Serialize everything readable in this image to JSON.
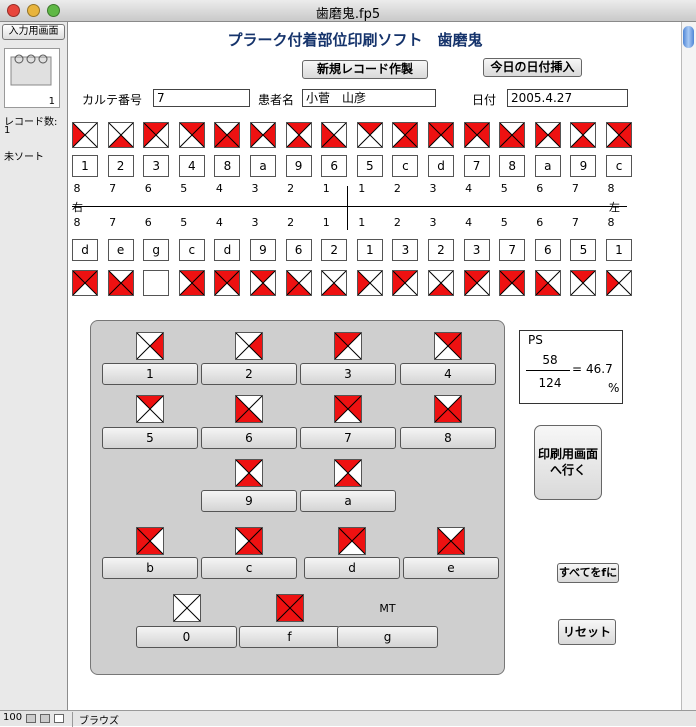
{
  "window": {
    "title": "歯磨鬼.fp5"
  },
  "sidebar": {
    "layout_button": "入力用画面",
    "record_number": "1",
    "records_label": "レコード数:",
    "records_count": "1",
    "sort_status": "未ソート"
  },
  "status": {
    "zoom": "100",
    "mode": "ブラウズ"
  },
  "header": {
    "title": "プラーク付着部位印刷ソフト　歯磨鬼",
    "new_record_button": "新規レコード作製",
    "insert_date_button": "今日の日付挿入"
  },
  "form": {
    "chart_no_label": "カルテ番号",
    "chart_no": "7",
    "patient_label": "患者名",
    "patient_name": "小菅　山彦",
    "date_label": "日付",
    "date": "2005.4.27"
  },
  "upper_codes": [
    "1",
    "2",
    "3",
    "4",
    "8",
    "a",
    "9",
    "6",
    "5",
    "c",
    "d",
    "7",
    "8",
    "a",
    "9",
    "c"
  ],
  "upper_numbers": [
    "8",
    "7",
    "6",
    "5",
    "4",
    "3",
    "2",
    "1",
    "1",
    "2",
    "3",
    "4",
    "5",
    "6",
    "7",
    "8"
  ],
  "lower_numbers": [
    "8",
    "7",
    "6",
    "5",
    "4",
    "3",
    "2",
    "1",
    "1",
    "2",
    "3",
    "4",
    "5",
    "6",
    "7",
    "8"
  ],
  "right_label": "右",
  "left_label": "左",
  "lower_codes": [
    "d",
    "e",
    "g",
    "c",
    "d",
    "9",
    "6",
    "2",
    "1",
    "3",
    "2",
    "3",
    "7",
    "6",
    "5",
    "1"
  ],
  "upper_teeth": [
    "1",
    "2",
    "3",
    "4",
    "8",
    "a",
    "9",
    "6",
    "5",
    "c",
    "d",
    "7",
    "8",
    "a",
    "9",
    "c"
  ],
  "lower_teeth": [
    "d",
    "e",
    "",
    "c",
    "d",
    "9",
    "6",
    "2",
    "1",
    "3",
    "2",
    "3",
    "7",
    "6",
    "5",
    "1"
  ],
  "patterns": {
    "0": [],
    "1": [
      "L"
    ],
    "2": [
      "B"
    ],
    "3": [
      "T",
      "L"
    ],
    "4": [
      "T",
      "R"
    ],
    "5": [
      "T"
    ],
    "6": [
      "L",
      "B"
    ],
    "7": [
      "T",
      "R",
      "L"
    ],
    "8": [
      "L",
      "R",
      "B"
    ],
    "9": [
      "T",
      "B"
    ],
    "a": [
      "L",
      "R"
    ],
    "b": [
      "T",
      "L",
      "B"
    ],
    "c": [
      "T",
      "R",
      "B"
    ],
    "d": [
      "T",
      "L",
      "R"
    ],
    "e": [
      "L",
      "R",
      "B"
    ],
    "f": [
      "T",
      "R",
      "B",
      "L"
    ],
    "g": [],
    "r": [
      "R"
    ]
  },
  "panel": {
    "row1": [
      {
        "icon": "r",
        "label": "1"
      },
      {
        "icon": "r",
        "label": "2"
      },
      {
        "icon": "3",
        "label": "3"
      },
      {
        "icon": "4",
        "label": "4"
      }
    ],
    "row2": [
      {
        "icon": "5",
        "label": "5"
      },
      {
        "icon": "6",
        "label": "6"
      },
      {
        "icon": "7",
        "label": "7"
      },
      {
        "icon": "8",
        "label": "8"
      }
    ],
    "row3": [
      {
        "icon": "9",
        "label": "9"
      },
      {
        "icon": "9",
        "label": "a"
      }
    ],
    "row4": [
      {
        "icon": "b",
        "label": "b"
      },
      {
        "icon": "c",
        "label": "c"
      },
      {
        "icon": "d",
        "label": "d"
      },
      {
        "icon": "e",
        "label": "e"
      }
    ],
    "row5": [
      {
        "icon": "0",
        "label": "0"
      },
      {
        "icon": "f",
        "label": "f"
      },
      {
        "icon": "",
        "label": "g",
        "caption": "MT"
      }
    ]
  },
  "ps": {
    "label": "PS",
    "numerator": "58",
    "denominator": "124",
    "equals": "=",
    "value": "46.7",
    "unit": "%"
  },
  "buttons": {
    "print_screen": "印刷用画面へ行く",
    "all_f": "すべてをfに",
    "reset": "リセット"
  },
  "colors": {
    "red": "#ee1111",
    "panel": "#cfcfcf"
  }
}
